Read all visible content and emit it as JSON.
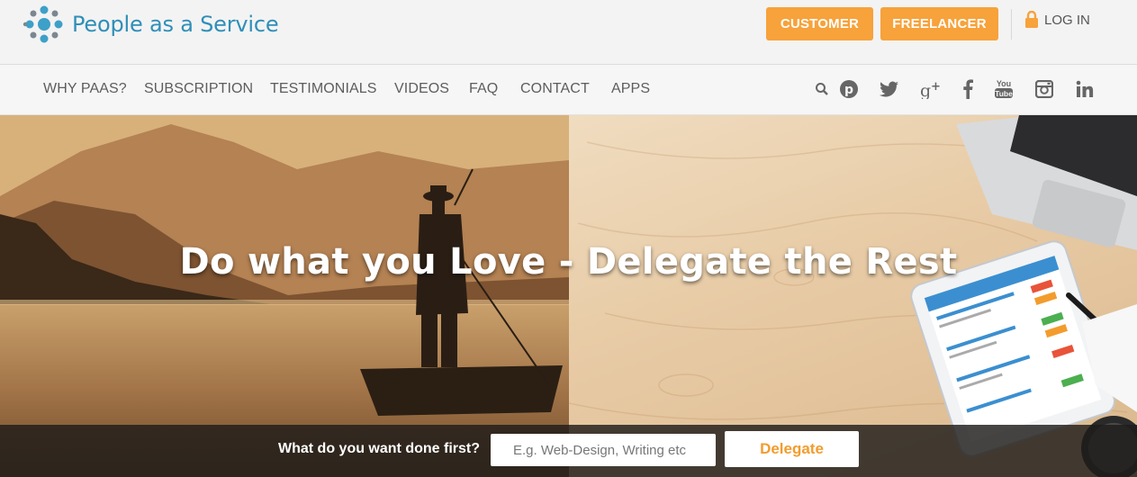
{
  "brand": {
    "name": "People as a Service"
  },
  "header": {
    "customer_label": "CUSTOMER",
    "freelancer_label": "FREELANCER",
    "login_label": "LOG IN"
  },
  "nav": {
    "items": [
      "WHY PAAS?",
      "SUBSCRIPTION",
      "TESTIMONIALS",
      "VIDEOS",
      "FAQ",
      "CONTACT",
      "APPS"
    ],
    "social_icons": [
      "search-icon",
      "pinterest-icon",
      "twitter-icon",
      "google-plus-icon",
      "facebook-icon",
      "youtube-icon",
      "instagram-icon",
      "linkedin-icon"
    ]
  },
  "hero": {
    "headline": "Do what you Love - Delegate the Rest",
    "prompt": "What do you want done first?",
    "input_placeholder": "E.g. Web-Design, Writing etc",
    "input_value": "",
    "delegate_label": "Delegate"
  },
  "colors": {
    "accent_orange": "#f7a23a",
    "brand_blue": "#2f8fb8"
  }
}
